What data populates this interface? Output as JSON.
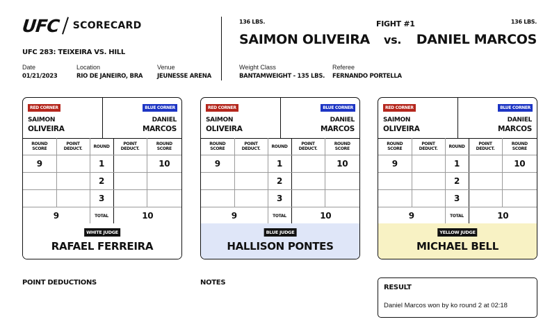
{
  "header": {
    "logo_text": "UFC",
    "logo_subtitle": "SCORECARD",
    "event": "UFC 283: TEIXEIRA VS. HILL",
    "date_label": "Date",
    "date": "01/21/2023",
    "location_label": "Location",
    "location": "RIO DE JANEIRO, BRA",
    "venue_label": "Venue",
    "venue": "JEUNESSE ARENA",
    "weight_class_label": "Weight Class",
    "weight_class": "BANTAMWEIGHT - 135 LBS.",
    "referee_label": "Referee",
    "referee": "FERNANDO PORTELLA"
  },
  "fight": {
    "number": "FIGHT #1",
    "vs": "vs.",
    "red": {
      "weight": "136 LBS.",
      "name": "SAIMON OLIVEIRA",
      "first": "SAIMON",
      "last": "OLIVEIRA"
    },
    "blue": {
      "weight": "136 LBS.",
      "name": "DANIEL MARCOS",
      "first": "DANIEL",
      "last": "MARCOS"
    }
  },
  "labels": {
    "red_corner": "RED CORNER",
    "blue_corner": "BLUE CORNER",
    "round_score": [
      "ROUND",
      "SCORE"
    ],
    "point_deduct": [
      "POINT",
      "DEDUCT."
    ],
    "round": "ROUND",
    "total": "TOTAL",
    "point_deductions": "POINT DEDUCTIONS",
    "notes": "NOTES",
    "result": "RESULT"
  },
  "cards": [
    {
      "judge_label": "WHITE JUDGE",
      "judge_name": "RAFAEL FERREIRA",
      "color": "#ffffff",
      "rounds": [
        {
          "n": "1",
          "red": "9",
          "red_ded": "",
          "blue_ded": "",
          "blue": "10"
        },
        {
          "n": "2",
          "red": "",
          "red_ded": "",
          "blue_ded": "",
          "blue": ""
        },
        {
          "n": "3",
          "red": "",
          "red_ded": "",
          "blue_ded": "",
          "blue": ""
        }
      ],
      "total_red": "9",
      "total_blue": "10"
    },
    {
      "judge_label": "BLUE JUDGE",
      "judge_name": "HALLISON PONTES",
      "color": "#dfe6f8",
      "rounds": [
        {
          "n": "1",
          "red": "9",
          "red_ded": "",
          "blue_ded": "",
          "blue": "10"
        },
        {
          "n": "2",
          "red": "",
          "red_ded": "",
          "blue_ded": "",
          "blue": ""
        },
        {
          "n": "3",
          "red": "",
          "red_ded": "",
          "blue_ded": "",
          "blue": ""
        }
      ],
      "total_red": "9",
      "total_blue": "10"
    },
    {
      "judge_label": "YELLOW JUDGE",
      "judge_name": "MICHAEL BELL",
      "color": "#f8f2c4",
      "rounds": [
        {
          "n": "1",
          "red": "9",
          "red_ded": "",
          "blue_ded": "",
          "blue": "10"
        },
        {
          "n": "2",
          "red": "",
          "red_ded": "",
          "blue_ded": "",
          "blue": ""
        },
        {
          "n": "3",
          "red": "",
          "red_ded": "",
          "blue_ded": "",
          "blue": ""
        }
      ],
      "total_red": "9",
      "total_blue": "10"
    }
  ],
  "result": {
    "text": "Daniel Marcos won by ko round 2 at 02:18"
  },
  "colors": {
    "red_corner": "#b5271d",
    "blue_corner": "#1d35c4"
  }
}
